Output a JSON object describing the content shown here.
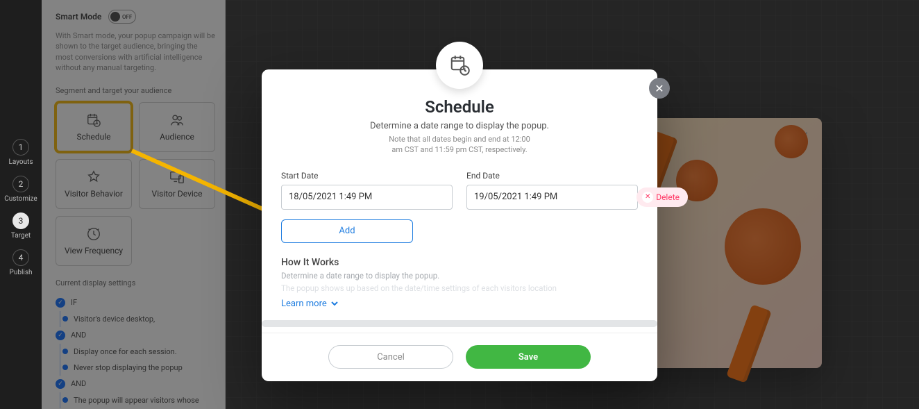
{
  "nav": {
    "steps": [
      {
        "num": "1",
        "label": "Layouts"
      },
      {
        "num": "2",
        "label": "Customize"
      },
      {
        "num": "3",
        "label": "Target"
      },
      {
        "num": "4",
        "label": "Publish"
      }
    ]
  },
  "sidepanel": {
    "smart_mode_label": "Smart Mode",
    "toggle_state": "OFF",
    "smart_desc": "With Smart mode, your popup campaign will be shown to the target audience, bringing the most conversions with artificial intelligence without any manual targeting.",
    "segment_label": "Segment and target your audience",
    "tiles": {
      "schedule": "Schedule",
      "audience": "Audience",
      "visitor_behavior": "Visitor Behavior",
      "visitor_device": "Visitor Device",
      "view_frequency": "View Frequency"
    },
    "current_settings_label": "Current display settings",
    "rules": {
      "if": "IF",
      "r1": "Visitor's device desktop,",
      "and1": "AND",
      "r2": "Display once for each session.",
      "r3": "Never stop displaying the popup",
      "and2": "AND",
      "r4": "The popup will appear visitors whose"
    }
  },
  "modal": {
    "title": "Schedule",
    "subtitle": "Determine a date range to display the popup.",
    "note_line1": "Note that all dates begin and end at 12:00",
    "note_line2": "am CST and 11:59 pm CST, respectively.",
    "start_label": "Start Date",
    "end_label": "End Date",
    "start_value": "18/05/2021 1:49 PM",
    "end_value": "19/05/2021 1:49 PM",
    "delete": "Delete",
    "add": "Add",
    "hiw_title": "How It Works",
    "hiw_line1": "Determine a date range to display the popup.",
    "hiw_line2": "The popup shows up based on the date/time settings of each visitors location",
    "learn_more": "Learn more",
    "cancel": "Cancel",
    "save": "Save"
  }
}
